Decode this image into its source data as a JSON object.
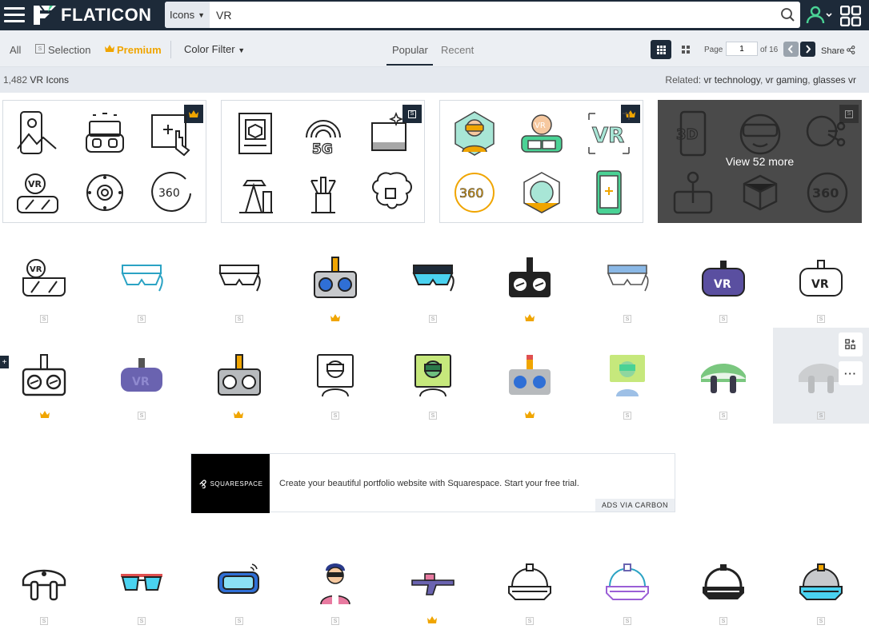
{
  "header": {
    "logo_text": "FLATICON",
    "search_type": "Icons",
    "search_value": "VR"
  },
  "subbar": {
    "filters": [
      "All",
      "Selection",
      "Premium"
    ],
    "color_filter": "Color Filter",
    "sort_tabs": [
      "Popular",
      "Recent"
    ],
    "page_label": "Page",
    "page_value": "1",
    "page_of": "of 16",
    "share_label": "Share"
  },
  "info": {
    "count": "1,482",
    "count_label": "VR Icons",
    "related_label": "Related:",
    "related": [
      "vr technology",
      "vr gaming",
      "glasses vr"
    ]
  },
  "packs": {
    "view_more": "View 52 more"
  },
  "ad": {
    "brand": "SQUARESPACE",
    "text": "Create your beautiful portfolio website with Squarespace. Start your free trial.",
    "tag": "ADS VIA CARBON"
  },
  "colors": {
    "navy": "#1d2a39",
    "premium": "#f0a500",
    "subbar_bg": "#eceff3"
  }
}
